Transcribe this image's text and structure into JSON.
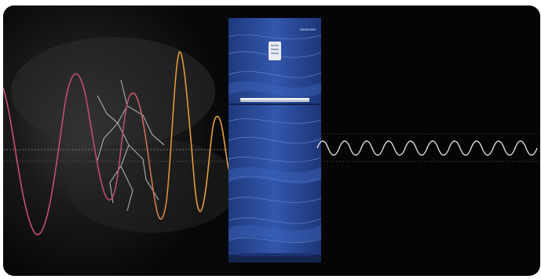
{
  "banner": {
    "fridge_brand": "SAMSUNG",
    "input_wave_colors": [
      "#d2506a",
      "#e29a35"
    ],
    "output_wave_color": "#d9d9d9",
    "fridge_color": "#2c4fa3",
    "background": "#050505"
  }
}
